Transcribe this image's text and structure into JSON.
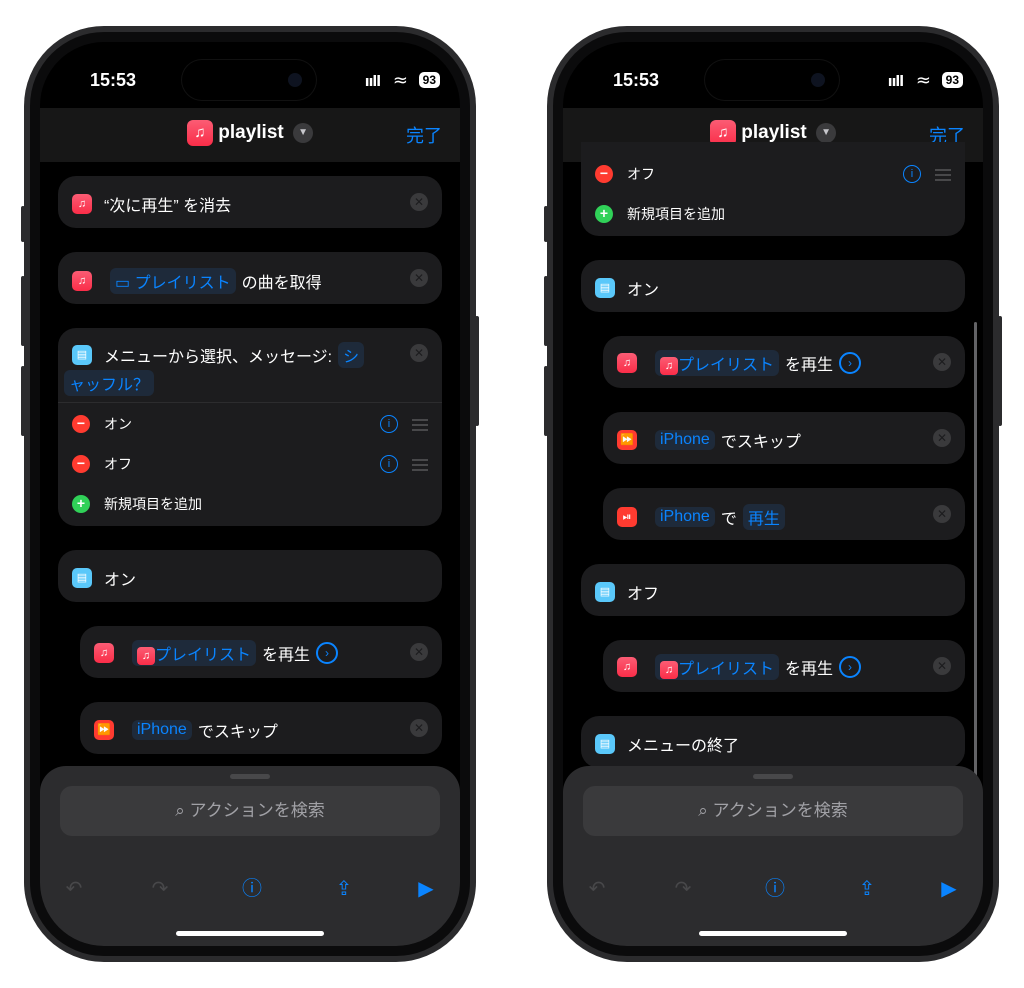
{
  "status": {
    "time": "15:53",
    "signal": "ııll",
    "wifi": "≈",
    "battery": "93"
  },
  "nav": {
    "title": "playlist",
    "done_label": "完了"
  },
  "phone1": {
    "clear_up_next": "“次に再生” を消去",
    "get_songs": {
      "param": "プレイリスト",
      "text": "の曲を取得"
    },
    "menu_select": {
      "text": "メニューから選択、メッセージ:",
      "param_part1": "シ",
      "param_part2": "ャッフル？"
    },
    "menu_items": [
      "オン",
      "オフ"
    ],
    "add_item": "新規項目を追加",
    "on_label": "オン",
    "play": {
      "param": "プレイリスト",
      "text": "を再生"
    },
    "skip": {
      "param": "iPhone",
      "text": "でスキップ"
    }
  },
  "phone2": {
    "off_item": "オフ",
    "add_item": "新規項目を追加",
    "on_label": "オン",
    "play1": {
      "param": "プレイリスト",
      "text": "を再生"
    },
    "skip": {
      "param": "iPhone",
      "text": "でスキップ"
    },
    "play_pause": {
      "param": "iPhone",
      "text": "で",
      "param2": "再生"
    },
    "off_label": "オフ",
    "play2": {
      "param": "プレイリスト",
      "text": "を再生"
    },
    "end_menu": "メニューの終了"
  },
  "search": {
    "placeholder": "アクションを検索"
  },
  "icons": {
    "music": "♫",
    "menu": "▤",
    "skip": "⏩",
    "playpause": "⏯",
    "undo": "↶",
    "redo": "↷",
    "info": "ⓘ",
    "share": "⇪",
    "play": "▶",
    "search": "⌕"
  },
  "colors": {
    "accent": "#0a84ff",
    "music": "#fa2d48",
    "menu": "#5ac8fa",
    "minus": "#ff3b30",
    "plus": "#30d158"
  }
}
